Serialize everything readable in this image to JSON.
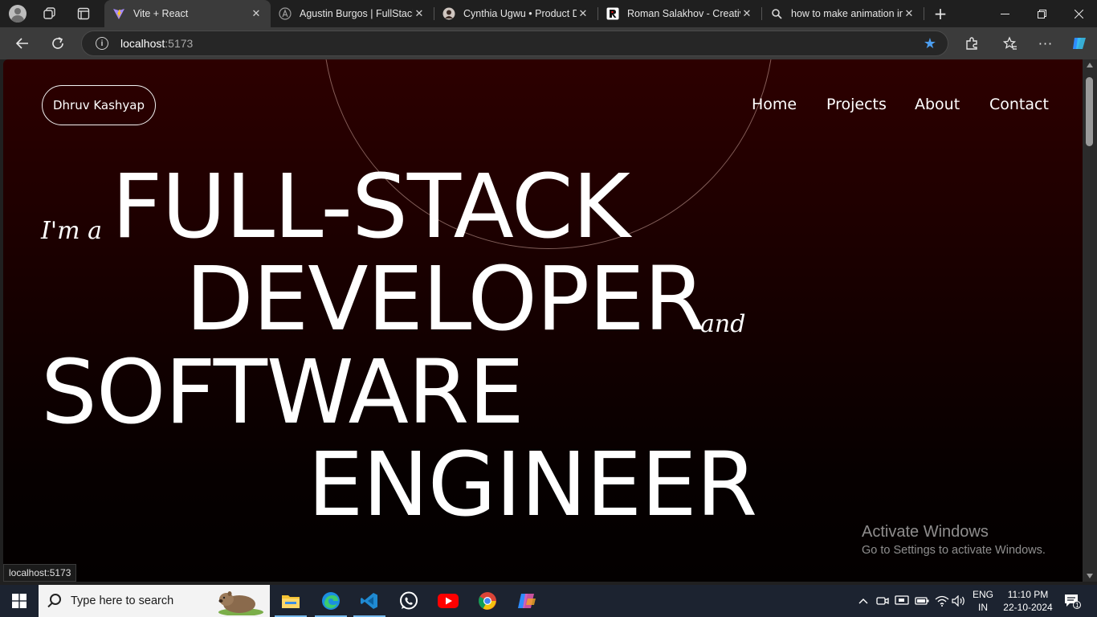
{
  "browser": {
    "tabs": [
      {
        "title": "Vite + React",
        "favicon": "vite-icon",
        "active": true
      },
      {
        "title": "Agustin Burgos | FullStack Dev",
        "favicon": "letter-a-icon",
        "active": false
      },
      {
        "title": "Cynthia Ugwu • Product Designer",
        "favicon": "avatar-icon",
        "active": false
      },
      {
        "title": "Roman Salakhov - Creative Dev",
        "favicon": "r-logo-icon",
        "active": false
      },
      {
        "title": "how to make animation infinite",
        "favicon": "search-icon",
        "active": false
      }
    ],
    "address": {
      "host": "localhost",
      "port": ":5173"
    },
    "status_url": "localhost:5173"
  },
  "page": {
    "brand": "Dhruv Kashyap",
    "nav": [
      "Home",
      "Projects",
      "About",
      "Contact"
    ],
    "hero": {
      "intro": "I'm a",
      "line1": "FULL-STACK",
      "line2": "DEVELOPER",
      "conj": "and",
      "line3": "SOFTWARE",
      "line4": "ENGINEER"
    },
    "activation": {
      "title": "Activate Windows",
      "subtitle": "Go to Settings to activate Windows."
    }
  },
  "taskbar": {
    "search_placeholder": "Type here to search",
    "apps": [
      "file-explorer-icon",
      "edge-icon",
      "vscode-icon",
      "whatsapp-icon",
      "youtube-icon",
      "chrome-icon",
      "copilot-icon"
    ],
    "language": "ENG",
    "region": "IN",
    "time": "11:10 PM",
    "date": "22-10-2024",
    "notification_count": "1"
  },
  "colors": {
    "page_top": "#2d0000",
    "page_bottom": "#030000",
    "accent_star": "#4c9ef0",
    "taskbar": "#1c2330"
  }
}
